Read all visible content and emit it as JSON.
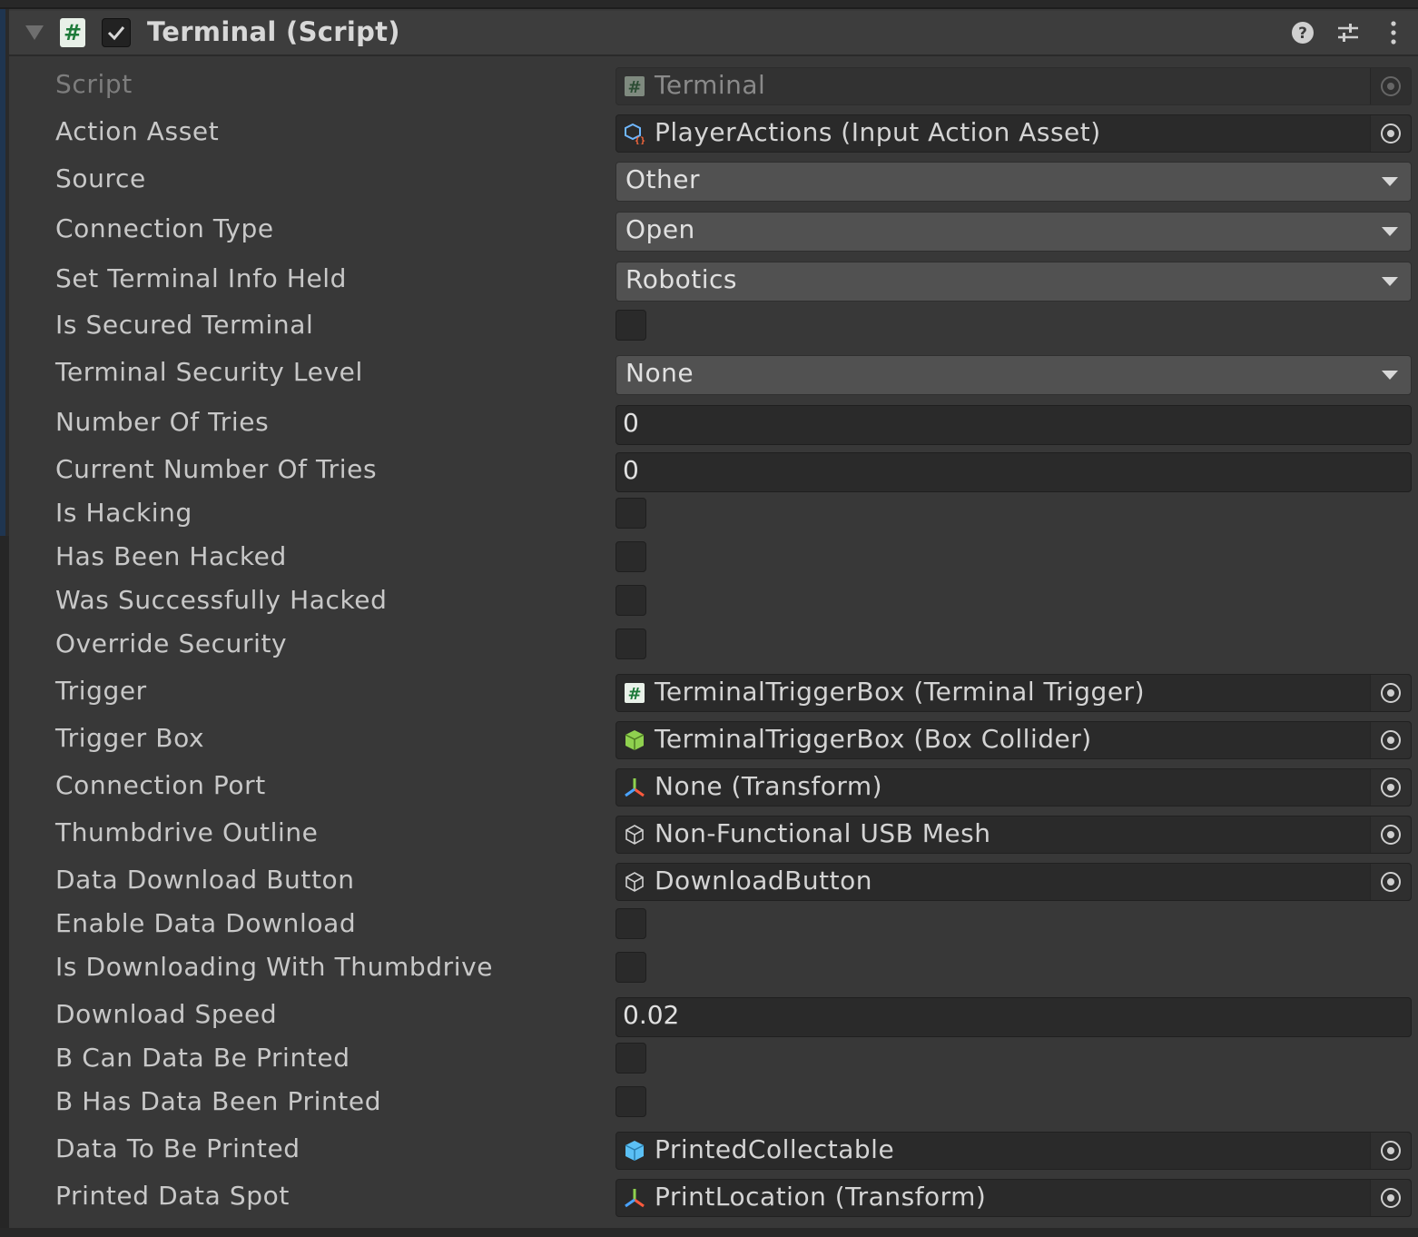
{
  "component": {
    "title": "Terminal (Script)",
    "enabled": true
  },
  "fields": {
    "script": {
      "label": "Script",
      "value": "Terminal"
    },
    "action_asset": {
      "label": "Action Asset",
      "value": "PlayerActions (Input Action Asset)"
    },
    "source": {
      "label": "Source",
      "value": "Other"
    },
    "connection_type": {
      "label": "Connection Type",
      "value": "Open"
    },
    "set_terminal_info_held": {
      "label": "Set Terminal Info Held",
      "value": "Robotics"
    },
    "is_secured_terminal": {
      "label": "Is Secured Terminal",
      "checked": false
    },
    "terminal_security_level": {
      "label": "Terminal Security Level",
      "value": "None"
    },
    "number_of_tries": {
      "label": "Number Of Tries",
      "value": "0"
    },
    "current_number_of_tries": {
      "label": "Current Number Of Tries",
      "value": "0"
    },
    "is_hacking": {
      "label": "Is Hacking",
      "checked": false
    },
    "has_been_hacked": {
      "label": "Has Been Hacked",
      "checked": false
    },
    "was_successfully_hacked": {
      "label": "Was Successfully Hacked",
      "checked": false
    },
    "override_security": {
      "label": "Override Security",
      "checked": false
    },
    "trigger": {
      "label": "Trigger",
      "value": "TerminalTriggerBox (Terminal Trigger)"
    },
    "trigger_box": {
      "label": "Trigger Box",
      "value": "TerminalTriggerBox (Box Collider)"
    },
    "connection_port": {
      "label": "Connection Port",
      "value": "None (Transform)"
    },
    "thumbdrive_outline": {
      "label": "Thumbdrive Outline",
      "value": "Non-Functional USB Mesh"
    },
    "data_download_button": {
      "label": "Data Download Button",
      "value": "DownloadButton"
    },
    "enable_data_download": {
      "label": "Enable Data Download",
      "checked": false
    },
    "is_downloading_with_thumbdrive": {
      "label": "Is Downloading With Thumbdrive",
      "checked": false
    },
    "download_speed": {
      "label": "Download Speed",
      "value": "0.02"
    },
    "b_can_data_be_printed": {
      "label": "B Can Data Be Printed",
      "checked": false
    },
    "b_has_data_been_printed": {
      "label": "B Has Data Been Printed",
      "checked": false
    },
    "data_to_be_printed": {
      "label": "Data To Be Printed",
      "value": "PrintedCollectable"
    },
    "printed_data_spot": {
      "label": "Printed Data Spot",
      "value": "PrintLocation (Transform)"
    }
  },
  "icons": {
    "header": [
      "foldout-arrow-icon",
      "script-hash-icon",
      "checkmark-icon",
      "help-icon",
      "presets-icon",
      "more-vertical-icon"
    ],
    "object_fields": [
      "script-hash-icon",
      "input-action-asset-icon",
      "box-collider-icon",
      "transform-icon",
      "mesh-icon",
      "prefab-icon",
      "object-picker-icon"
    ]
  },
  "colors": {
    "background": "#383838",
    "field_background": "#2a2a2a",
    "dropdown_background": "#515151",
    "label_text": "#c8c8c8",
    "script_hash_green": "#1e7a3a",
    "box_collider_green": "#8fd14f",
    "prefab_blue": "#5bc0f5"
  }
}
